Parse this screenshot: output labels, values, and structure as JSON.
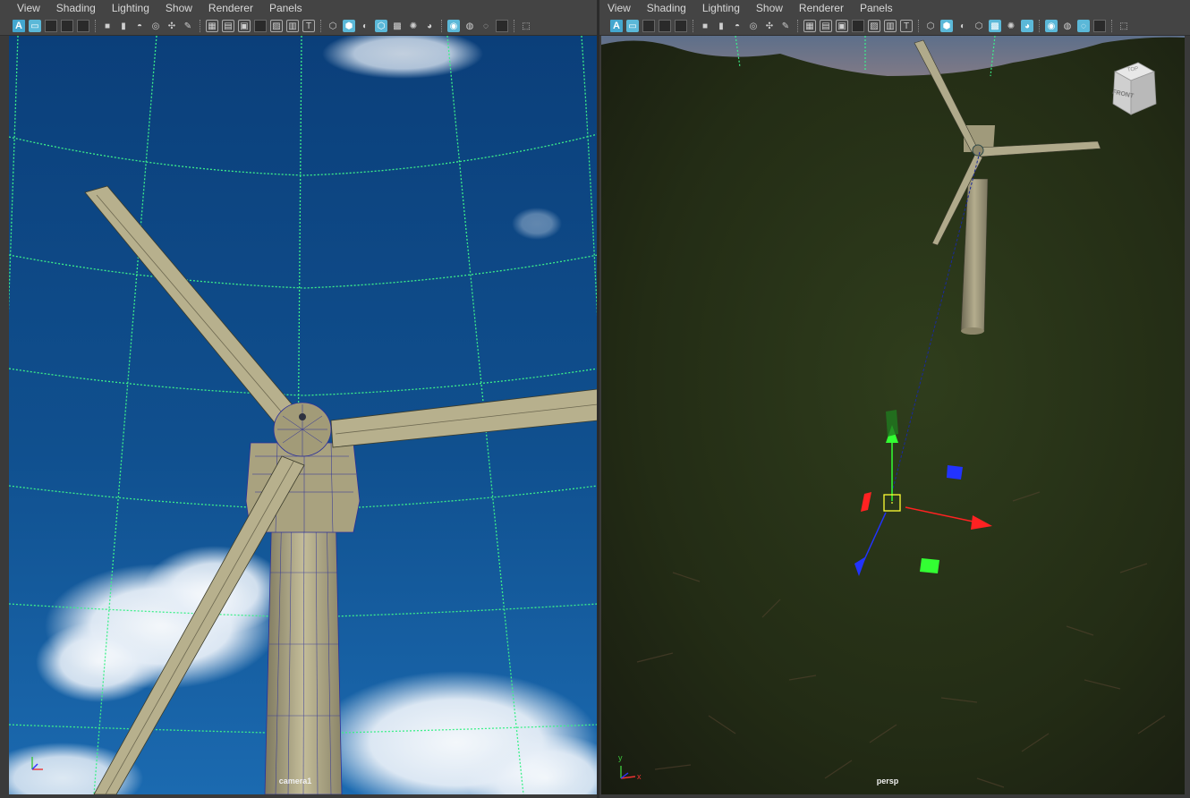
{
  "menus": [
    "View",
    "Shading",
    "Lighting",
    "Show",
    "Renderer",
    "Panels"
  ],
  "viewports": [
    {
      "camera": "camera1"
    },
    {
      "camera": "persp"
    }
  ],
  "view_cube": {
    "face_label": "FRONT",
    "top_label": "TOP"
  },
  "axis_labels": {
    "x": "x",
    "y": "y"
  },
  "colors": {
    "accent": "#43a7cf",
    "sky": "#0f4a86",
    "grid": "#3df08a",
    "ground": "#243016"
  }
}
